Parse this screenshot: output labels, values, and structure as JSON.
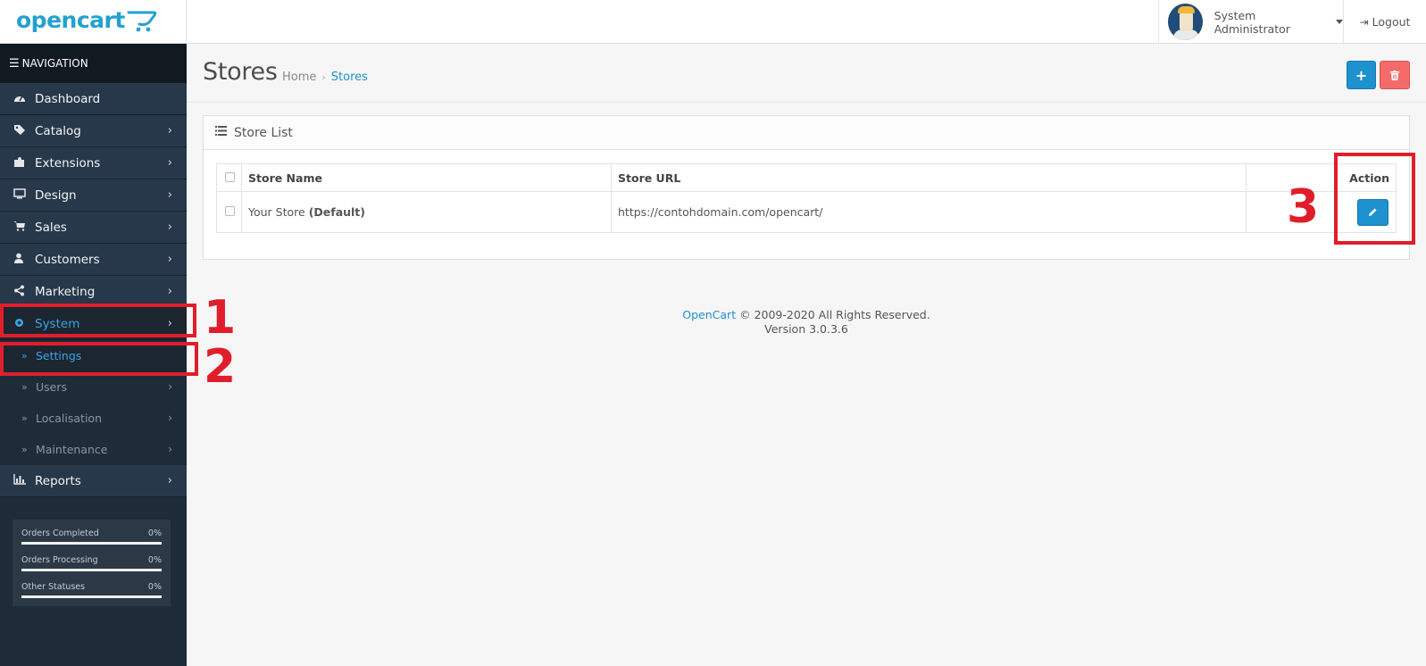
{
  "header": {
    "logo_text": "opencart",
    "user_name": "System Administrator",
    "logout_label": "Logout"
  },
  "sidebar": {
    "nav_title": "NAVIGATION",
    "items": [
      {
        "label": "Dashboard",
        "icon": "dashboard-icon"
      },
      {
        "label": "Catalog",
        "icon": "tags-icon"
      },
      {
        "label": "Extensions",
        "icon": "puzzle-icon"
      },
      {
        "label": "Design",
        "icon": "monitor-icon"
      },
      {
        "label": "Sales",
        "icon": "cart-icon"
      },
      {
        "label": "Customers",
        "icon": "user-icon"
      },
      {
        "label": "Marketing",
        "icon": "share-icon"
      },
      {
        "label": "System",
        "icon": "gear-icon"
      }
    ],
    "sub_items": [
      {
        "label": "Settings"
      },
      {
        "label": "Users"
      },
      {
        "label": "Localisation"
      },
      {
        "label": "Maintenance"
      }
    ],
    "reports_label": "Reports",
    "stats": [
      {
        "label": "Orders Completed",
        "value": "0%",
        "fraction": 0
      },
      {
        "label": "Orders Processing",
        "value": "0%",
        "fraction": 0
      },
      {
        "label": "Other Statuses",
        "value": "0%",
        "fraction": 0
      }
    ]
  },
  "page": {
    "title": "Stores",
    "breadcrumb_home": "Home",
    "breadcrumb_sep": "›",
    "breadcrumb_current": "Stores"
  },
  "panel": {
    "title": "Store List",
    "columns": {
      "name": "Store Name",
      "url": "Store URL",
      "action": "Action"
    },
    "rows": [
      {
        "name": "Your Store",
        "name_suffix": "(Default)",
        "url": "https://contohdomain.com/opencart/"
      }
    ]
  },
  "footer": {
    "brand": "OpenCart",
    "copyright": "© 2009-2020 All Rights Reserved.",
    "version": "Version 3.0.3.6"
  },
  "annotations": [
    "1",
    "2",
    "3"
  ],
  "colors": {
    "accent": "#1e91cf",
    "danger": "#f56b6b",
    "annotation": "#e01e2b",
    "sidebar_bg": "#1e2b38"
  }
}
